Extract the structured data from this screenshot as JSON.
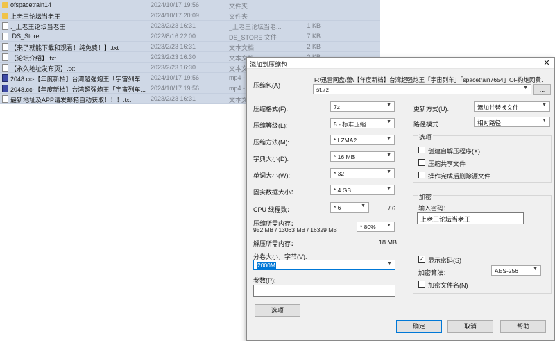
{
  "file_list": [
    {
      "icon": "folder-icon",
      "name": "ofspacetrain14",
      "date": "2024/10/17 19:56",
      "type": "文件夹",
      "size": ""
    },
    {
      "icon": "folder-icon",
      "name": "上老王论坛当老王",
      "date": "2024/10/17 20:09",
      "type": "文件夹",
      "size": ""
    },
    {
      "icon": "document-icon",
      "name": "._上老王论坛当老王",
      "date": "2023/2/23 16:31",
      "type": "_上老王论坛当老...",
      "size": "1 KB"
    },
    {
      "icon": "document-icon",
      "name": ".DS_Store",
      "date": "2022/8/16 22:00",
      "type": "DS_STORE 文件",
      "size": "7 KB"
    },
    {
      "icon": "document-icon",
      "name": "【来了就能下载和观看！纯免费！】.txt",
      "date": "2023/2/23 16:31",
      "type": "文本文档",
      "size": "2 KB"
    },
    {
      "icon": "document-icon",
      "name": "【论坛介绍】.txt",
      "date": "2023/2/23 16:30",
      "type": "文本文档",
      "size": "2 KB"
    },
    {
      "icon": "document-icon",
      "name": "【永久地址发布页】.txt",
      "date": "2023/2/23 16:30",
      "type": "文本文档",
      "size": "2 KB"
    },
    {
      "icon": "video-icon",
      "name": "2048.cc-【年度新档】台湾超强炮王「宇宙列车...",
      "date": "2024/10/17 19:56",
      "type": "mp4 - ",
      "size": ""
    },
    {
      "icon": "video-icon",
      "name": "2048.cc-【年度新档】台湾超强炮王「宇宙列车...",
      "date": "2024/10/17 19:56",
      "type": "mp4 - ",
      "size": ""
    },
    {
      "icon": "document-icon",
      "name": "最新地址及APP请发邮箱自动获取！！！.txt",
      "date": "2023/2/23 16:31",
      "type": "文本文档",
      "size": ""
    }
  ],
  "dialog": {
    "title": "添加到压缩包",
    "close": "✕",
    "archive_label": "压缩包(A)",
    "archive_path_line1": "F:\\迅雷网盘\\蕾\\【年度新档】台湾超强炮王「宇宙列车」「spacetrain7654」OF约炮网黄、良家、学生",
    "archive_path_line2": "st.7z",
    "browse_label": "...",
    "format_label": "压缩格式(F):",
    "format_value": "7z",
    "level_label": "压缩等级(L):",
    "level_value": "5 - 标准压缩",
    "method_label": "压缩方法(M):",
    "method_value": "* LZMA2",
    "dict_label": "字典大小(D):",
    "dict_value": "* 16 MB",
    "word_label": "单词大小(W):",
    "word_value": "* 32",
    "solid_label": "固实数据大小：",
    "solid_value": "* 4 GB",
    "threads_label": "CPU 线程数：",
    "threads_value": "* 6",
    "threads_total": "/ 6",
    "mem_comp_label": "压缩所需内存：",
    "mem_comp_value": "952 MB / 13063 MB / 16329 MB",
    "mem_percent": "* 80%",
    "mem_decomp_label": "解压所需内存：",
    "mem_decomp_value": "18 MB",
    "split_label": "分卷大小，字节(V):",
    "split_value": "2000M",
    "params_label": "参数(P):",
    "params_value": "",
    "options_button": "选项",
    "update_label": "更新方式(U):",
    "update_value": "添加并替换文件",
    "path_label": "路径模式",
    "path_value": "相对路径",
    "options_group": "选项",
    "opt_sfx": "创建自解压程序(X)",
    "opt_shared": "压缩共享文件",
    "opt_delete": "操作完成后删除源文件",
    "encrypt_group": "加密",
    "password_label": "输入密码：",
    "password_value": "上老王论坛当老王",
    "show_password": "显示密码(S)",
    "show_password_mark": "✓",
    "encrypt_method_label": "加密算法：",
    "encrypt_method_value": "AES-256",
    "encrypt_names": "加密文件名(N)",
    "ok": "确定",
    "cancel": "取消",
    "help": "帮助"
  }
}
